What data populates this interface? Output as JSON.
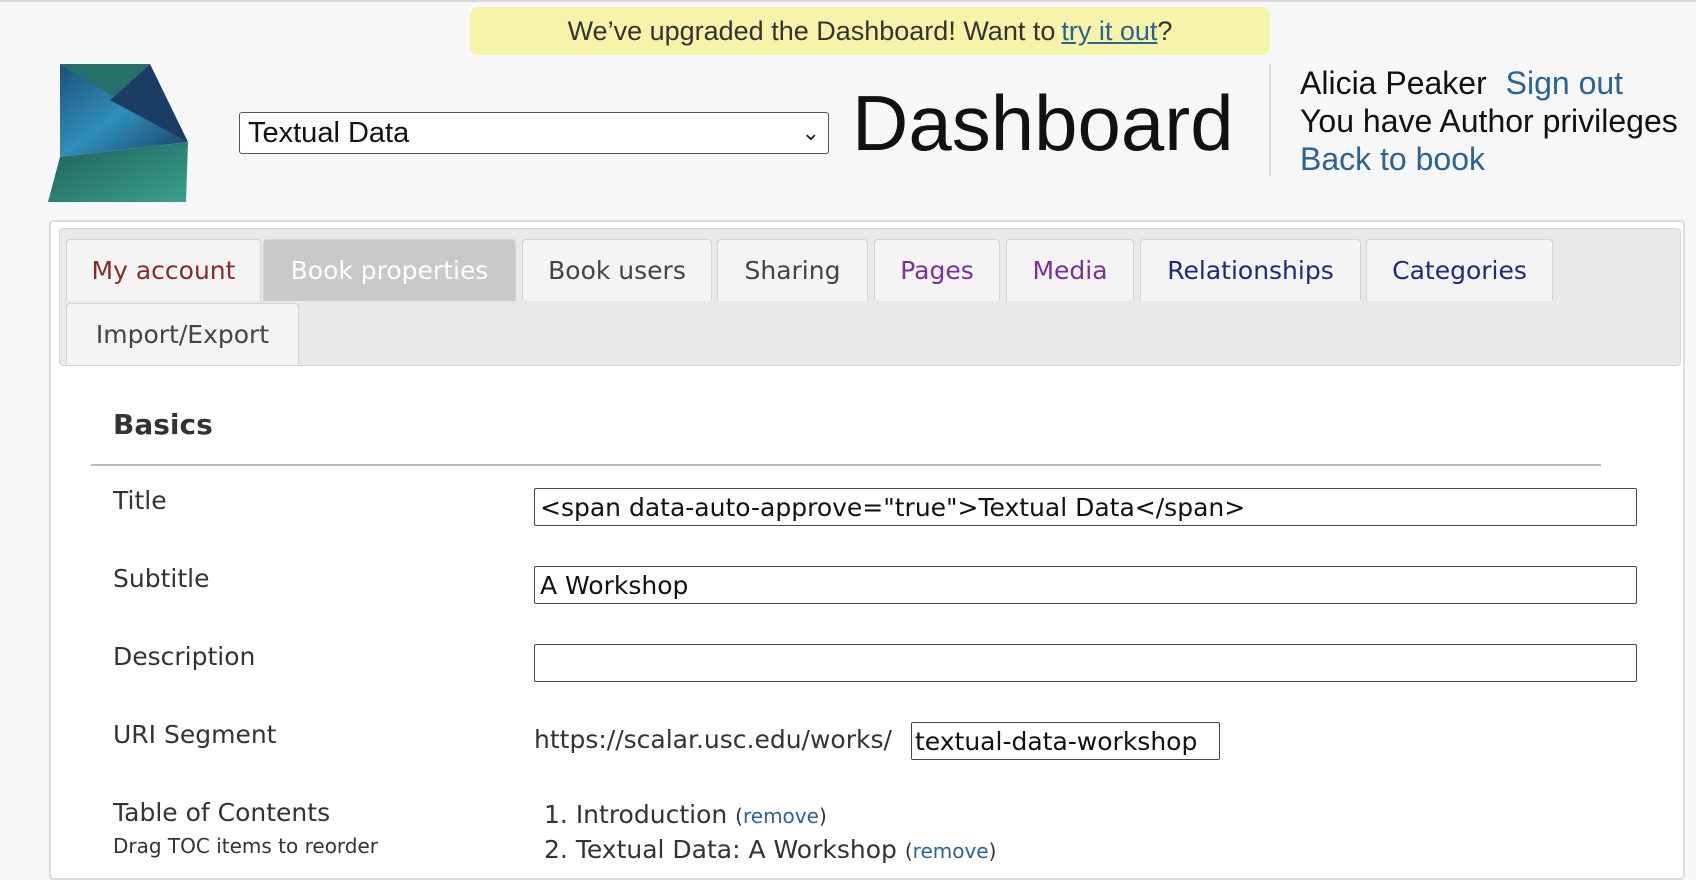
{
  "banner": {
    "text": "We’ve upgraded the Dashboard! Want to",
    "link": "try it out",
    "suffix": "?"
  },
  "book_select": {
    "selected": "Textual Data"
  },
  "header": {
    "title": "Dashboard"
  },
  "user": {
    "name": "Alicia Peaker",
    "sign_out": "Sign out",
    "privileges": "You have Author privileges",
    "back_link": "Back to book"
  },
  "tabs": [
    {
      "label": "My account",
      "color": "#8b2a2a"
    },
    {
      "label": "Book properties",
      "color": "#ffffff"
    },
    {
      "label": "Book users",
      "color": "#444444"
    },
    {
      "label": "Sharing",
      "color": "#444444"
    },
    {
      "label": "Pages",
      "color": "#7b2f9a"
    },
    {
      "label": "Media",
      "color": "#7b2f9a"
    },
    {
      "label": "Relationships",
      "color": "#1f2a7a"
    },
    {
      "label": "Categories",
      "color": "#1f2a7a"
    },
    {
      "label": "Import/Export",
      "color": "#444444"
    }
  ],
  "form": {
    "section_title": "Basics",
    "title_label": "Title",
    "title_value": "<span data-auto-approve=\"true\">Textual Data</span>",
    "subtitle_label": "Subtitle",
    "subtitle_value": "A Workshop",
    "description_label": "Description",
    "description_value": "",
    "uri_label": "URI Segment",
    "uri_prefix": "https://scalar.usc.edu/works/",
    "uri_value": "textual-data-workshop",
    "toc_label": "Table of Contents",
    "toc_hint": "Drag TOC items to reorder",
    "toc_items": [
      {
        "num": "1.",
        "title": "Introduction",
        "remove": "remove"
      },
      {
        "num": "2.",
        "title": "Textual Data: A Workshop",
        "remove": "remove"
      }
    ]
  },
  "colors": {
    "link": "#2a6496",
    "banner_bg": "#f7f3a8"
  }
}
